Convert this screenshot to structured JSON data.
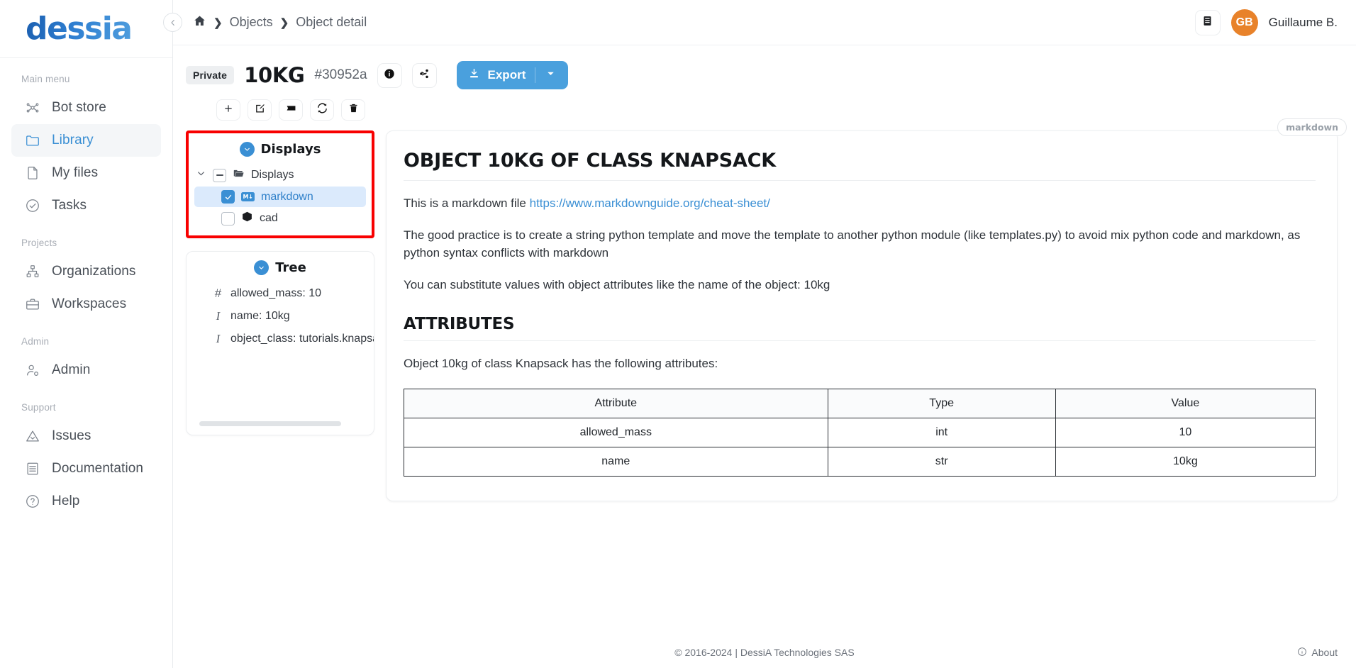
{
  "brand": {
    "logo_text": "dessia"
  },
  "sidebar": {
    "sections": [
      {
        "label": "Main menu",
        "items": [
          {
            "label": "Bot store",
            "icon": "bot-store-icon",
            "active": false
          },
          {
            "label": "Library",
            "icon": "folder-icon",
            "active": true
          },
          {
            "label": "My files",
            "icon": "file-icon",
            "active": false
          },
          {
            "label": "Tasks",
            "icon": "check-circle-icon",
            "active": false
          }
        ]
      },
      {
        "label": "Projects",
        "items": [
          {
            "label": "Organizations",
            "icon": "organizations-icon",
            "active": false
          },
          {
            "label": "Workspaces",
            "icon": "briefcase-icon",
            "active": false
          }
        ]
      },
      {
        "label": "Admin",
        "items": [
          {
            "label": "Admin",
            "icon": "user-gear-icon",
            "active": false
          }
        ]
      },
      {
        "label": "Support",
        "items": [
          {
            "label": "Issues",
            "icon": "warning-triangle-icon",
            "active": false
          },
          {
            "label": "Documentation",
            "icon": "book-icon",
            "active": false
          },
          {
            "label": "Help",
            "icon": "question-circle-icon",
            "active": false
          }
        ]
      }
    ]
  },
  "topbar": {
    "breadcrumb": {
      "home_icon": "home-icon",
      "items": [
        "Objects",
        "Object detail"
      ],
      "separator": "❯"
    },
    "notebook_icon": "notebook-icon",
    "user": {
      "initials": "GB",
      "name": "Guillaume B.",
      "avatar_color": "#e8822a"
    }
  },
  "object_header": {
    "visibility_badge": "Private",
    "title": "10KG",
    "id": "#30952a",
    "info_icon": "info-icon",
    "share_icon": "share-icon",
    "export_label": "Export",
    "export_icon": "download-icon",
    "export_caret_icon": "chevron-down-icon"
  },
  "toolbar": {
    "buttons": [
      {
        "name": "add-button",
        "icon": "plus-icon"
      },
      {
        "name": "edit-button",
        "icon": "edit-pencil-icon"
      },
      {
        "name": "tag-button",
        "icon": "tag-icon"
      },
      {
        "name": "refresh-button",
        "icon": "refresh-icon"
      },
      {
        "name": "delete-button",
        "icon": "trash-icon"
      }
    ]
  },
  "displays_panel": {
    "title": "Displays",
    "collapse_icon": "chevron-down-circle-icon",
    "highlighted": true,
    "root": {
      "label": "Displays",
      "caret_icon": "chevron-down-icon",
      "checkbox_state": "indeterminate",
      "icon": "folder-open-icon"
    },
    "children": [
      {
        "label": "markdown",
        "checkbox_state": "checked",
        "icon": "markdown-icon",
        "selected": true
      },
      {
        "label": "cad",
        "checkbox_state": "unchecked",
        "icon": "cube-icon",
        "selected": false
      }
    ]
  },
  "tree_panel": {
    "title": "Tree",
    "collapse_icon": "chevron-down-circle-icon",
    "rows": [
      {
        "type_icon": "#",
        "text": "allowed_mass: 10"
      },
      {
        "type_icon": "I",
        "text": "name: 10kg"
      },
      {
        "type_icon": "I",
        "text": "object_class: tutorials.knapsack_prob"
      }
    ]
  },
  "markdown_card": {
    "tab_label": "markdown",
    "h1": "OBJECT 10KG OF CLASS KNAPSACK",
    "p1_before": "This is a markdown file ",
    "p1_link": "https://www.markdownguide.org/cheat-sheet/",
    "p2": "The good practice is to create a string python template and move the template to another python module (like templates.py) to avoid mix python code and markdown, as python syntax conflicts with markdown",
    "p3": "You can substitute values with object attributes like the name of the object: 10kg",
    "h2": "ATTRIBUTES",
    "p4": "Object 10kg of class Knapsack has the following attributes:",
    "table": {
      "headers": [
        "Attribute",
        "Type",
        "Value"
      ],
      "rows": [
        [
          "allowed_mass",
          "int",
          "10"
        ],
        [
          "name",
          "str",
          "10kg"
        ]
      ]
    }
  },
  "footer": {
    "copyright": "© 2016-2024 | DessiA Technologies SAS",
    "about_label": "About",
    "about_icon": "info-circle-icon"
  },
  "colors": {
    "accent": "#3a8fd4",
    "export": "#4aa0dd",
    "highlight": "#f80000",
    "avatar": "#e8822a"
  }
}
